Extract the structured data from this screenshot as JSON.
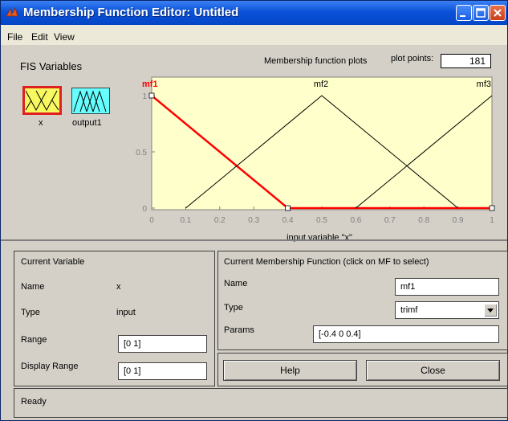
{
  "window": {
    "title": "Membership Function Editor: Untitled"
  },
  "menu": {
    "file": "File",
    "edit": "Edit",
    "view": "View"
  },
  "fis_variables": {
    "heading": "FIS Variables",
    "input_name": "x",
    "output_name": "output1"
  },
  "plot": {
    "heading": "Membership function plots",
    "plot_points_label": "plot points:",
    "plot_points_value": "181",
    "xlabel": "input variable \"x\"",
    "mf_labels": [
      "mf1",
      "mf2",
      "mf3"
    ],
    "colors": {
      "selected": "#ff0000",
      "normal": "#000000",
      "background": "#ffffcc"
    }
  },
  "chart_data": {
    "type": "line",
    "xlabel": "input variable \"x\"",
    "xlim": [
      0,
      1
    ],
    "ylim": [
      0,
      1
    ],
    "x_ticks": [
      "0",
      "0.1",
      "0.2",
      "0.3",
      "0.4",
      "0.5",
      "0.6",
      "0.7",
      "0.8",
      "0.9",
      "1"
    ],
    "y_ticks": [
      "0",
      "0.5",
      "1"
    ],
    "series": [
      {
        "name": "mf1",
        "x": [
          0,
          0.4,
          1
        ],
        "y": [
          1,
          0,
          0
        ],
        "selected": true
      },
      {
        "name": "mf2",
        "x": [
          0.1,
          0.5,
          0.9
        ],
        "y": [
          0,
          1,
          0
        ],
        "selected": false
      },
      {
        "name": "mf3",
        "x": [
          0.6,
          1.0
        ],
        "y": [
          0,
          1
        ],
        "selected": false
      }
    ]
  },
  "current_variable": {
    "heading": "Current Variable",
    "name_label": "Name",
    "name_value": "x",
    "type_label": "Type",
    "type_value": "input",
    "range_label": "Range",
    "range_value": "[0 1]",
    "display_range_label": "Display Range",
    "display_range_value": "[0 1]"
  },
  "current_mf": {
    "heading": "Current Membership Function (click on MF to select)",
    "name_label": "Name",
    "name_value": "mf1",
    "type_label": "Type",
    "type_value": "trimf",
    "params_label": "Params",
    "params_value": "[-0.4 0 0.4]"
  },
  "buttons": {
    "help": "Help",
    "close": "Close"
  },
  "status": "Ready"
}
